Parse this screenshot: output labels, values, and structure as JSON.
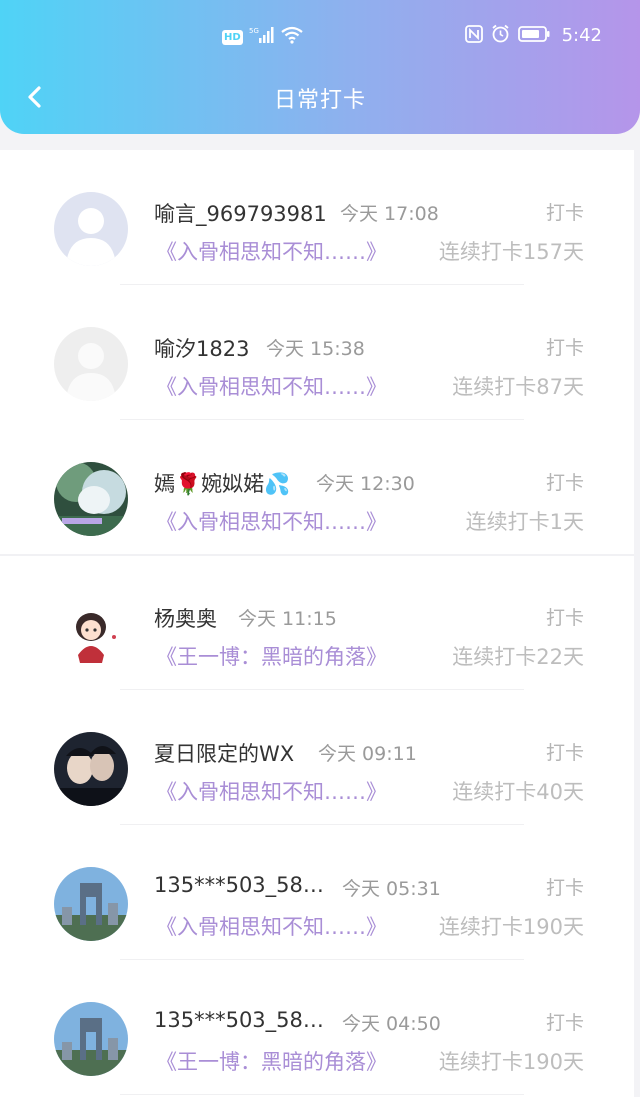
{
  "status_bar": {
    "hd": "HD",
    "network": "5G",
    "time": "5:42",
    "icons": [
      "signal-icon",
      "wifi-icon",
      "nfc-icon",
      "alarm-icon",
      "battery-icon"
    ]
  },
  "header": {
    "title": "日常打卡",
    "gradient": [
      "#4fd3f6",
      "#b595ea"
    ]
  },
  "items": [
    {
      "name": "喻言_969793981",
      "time": "今天 17:08",
      "action": "打卡",
      "book": "《入骨相思知不知……》",
      "streak": "连续打卡157天",
      "avatar": "default-avatar-blue"
    },
    {
      "name": "喻汐1823",
      "time": "今天 15:38",
      "action": "打卡",
      "book": "《入骨相思知不知……》",
      "streak": "连续打卡87天",
      "avatar": "default-avatar-grey"
    },
    {
      "name": "嫣🌹婉姒婼💦",
      "time": "今天 12:30",
      "action": "打卡",
      "book": "《入骨相思知不知……》",
      "streak": "连续打卡1天",
      "avatar": "photo-avatar"
    },
    {
      "name": "杨奥奥",
      "time": "今天 11:15",
      "action": "打卡",
      "book": "《王一博：黑暗的角落》",
      "streak": "连续打卡22天",
      "avatar": "cartoon-avatar"
    },
    {
      "name": "夏日限定的WX",
      "time": "今天 09:11",
      "action": "打卡",
      "book": "《入骨相思知不知……》",
      "streak": "连续打卡40天",
      "avatar": "photo-avatar-dark"
    },
    {
      "name": "135***503_58…",
      "time": "今天 05:31",
      "action": "打卡",
      "book": "《入骨相思知不知……》",
      "streak": "连续打卡190天",
      "avatar": "building-avatar"
    },
    {
      "name": "135***503_58…",
      "time": "今天 04:50",
      "action": "打卡",
      "book": "《王一博：黑暗的角落》",
      "streak": "连续打卡190天",
      "avatar": "building-avatar"
    }
  ]
}
